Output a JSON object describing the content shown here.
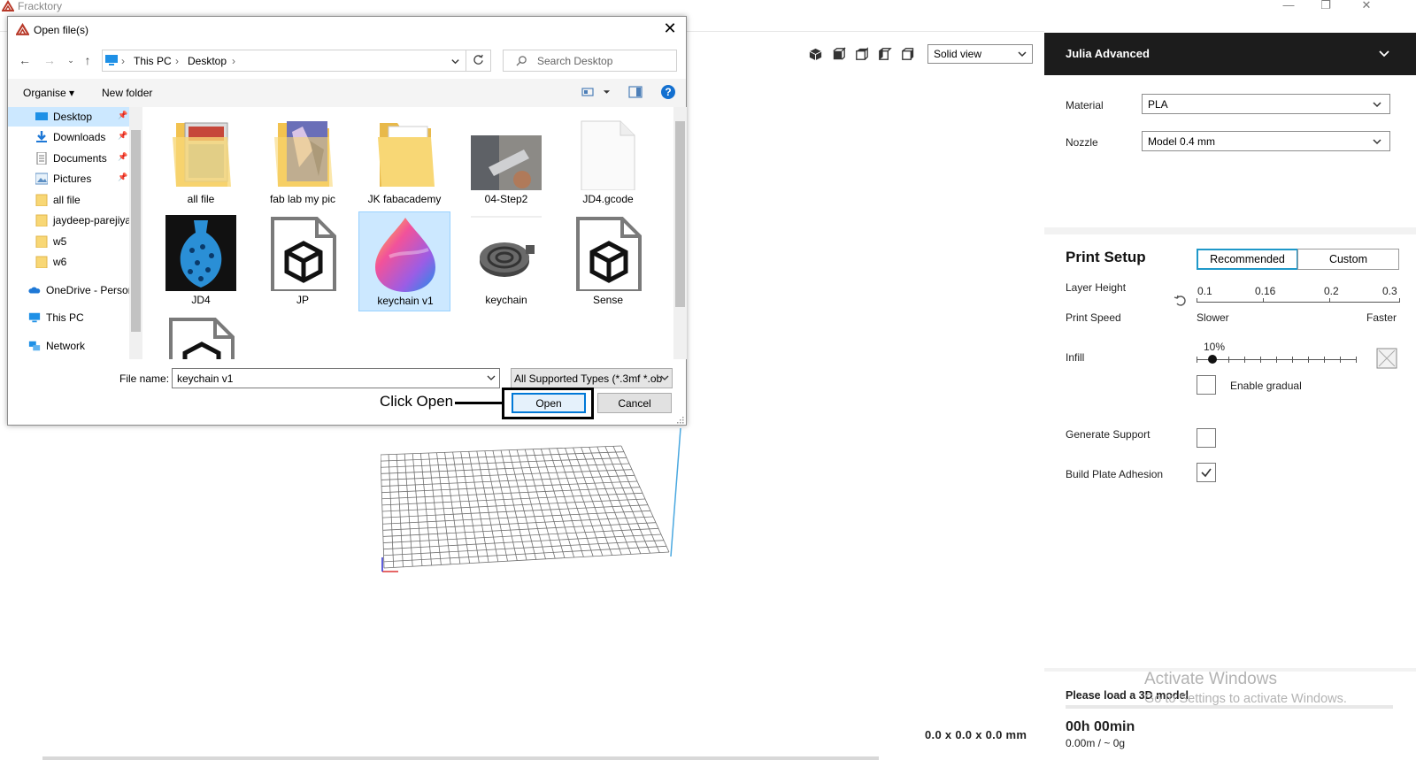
{
  "app": {
    "title": "Fracktory",
    "window_controls": {
      "minimize": "—",
      "maximize": "❐",
      "close": "✕"
    }
  },
  "viewport": {
    "view_mode": "Solid view",
    "dimensions": "0.0 x 0.0 x 0.0 mm"
  },
  "sidebar": {
    "printer": "Julia Advanced",
    "material_label": "Material",
    "material_value": "PLA",
    "nozzle_label": "Nozzle",
    "nozzle_value": "Model 0.4 mm",
    "print_setup_title": "Print Setup",
    "mode_recommended": "Recommended",
    "mode_custom": "Custom",
    "layer_height_label": "Layer Height",
    "layer_height_ticks": [
      "0.1",
      "0.16",
      "0.2",
      "0.3"
    ],
    "print_speed_label": "Print Speed",
    "speed_slower": "Slower",
    "speed_faster": "Faster",
    "infill_label": "Infill",
    "infill_value": "10%",
    "infill_fraction": 0.1,
    "enable_gradual_label": "Enable gradual",
    "enable_gradual_checked": false,
    "generate_support_label": "Generate Support",
    "generate_support_checked": false,
    "build_plate_adhesion_label": "Build Plate Adhesion",
    "build_plate_adhesion_checked": true,
    "status": "Please load a 3D model",
    "time": "00h 00min",
    "usage": "0.00m / ~ 0g",
    "accent": "#1f98c9"
  },
  "watermark": {
    "line1": "Activate Windows",
    "line2": "Go to Settings to activate Windows."
  },
  "dialog": {
    "title": "Open file(s)",
    "close": "✕",
    "breadcrumb": [
      "This PC",
      "Desktop"
    ],
    "search_placeholder": "Search Desktop",
    "organise": "Organise ▾",
    "new_folder": "New folder",
    "help": "?",
    "nav_items": [
      {
        "label": "Desktop",
        "pinned": true
      },
      {
        "label": "Downloads",
        "pinned": true
      },
      {
        "label": "Documents",
        "pinned": true
      },
      {
        "label": "Pictures",
        "pinned": true
      },
      {
        "label": "all file",
        "pinned": false
      },
      {
        "label": "jaydeep-parejiya",
        "pinned": false
      },
      {
        "label": "w5",
        "pinned": false
      },
      {
        "label": "w6",
        "pinned": false
      },
      {
        "label": "OneDrive - Persor",
        "pinned": false
      },
      {
        "label": "This PC",
        "pinned": false
      },
      {
        "label": "Network",
        "pinned": false
      }
    ],
    "files": [
      {
        "label": "all file"
      },
      {
        "label": "fab lab my pic"
      },
      {
        "label": "JK fabacademy"
      },
      {
        "label": "04-Step2"
      },
      {
        "label": "JD4.gcode"
      },
      {
        "label": "JD4"
      },
      {
        "label": "JP"
      },
      {
        "label": "keychain  v1"
      },
      {
        "label": "keychain"
      },
      {
        "label": "Sense"
      },
      {
        "label": ""
      }
    ],
    "file_name_label": "File name:",
    "file_name_value": "keychain  v1",
    "file_type_value": "All Supported Types (*.3mf *.ob",
    "open_button": "Open",
    "cancel_button": "Cancel",
    "callout": "Click Open"
  }
}
